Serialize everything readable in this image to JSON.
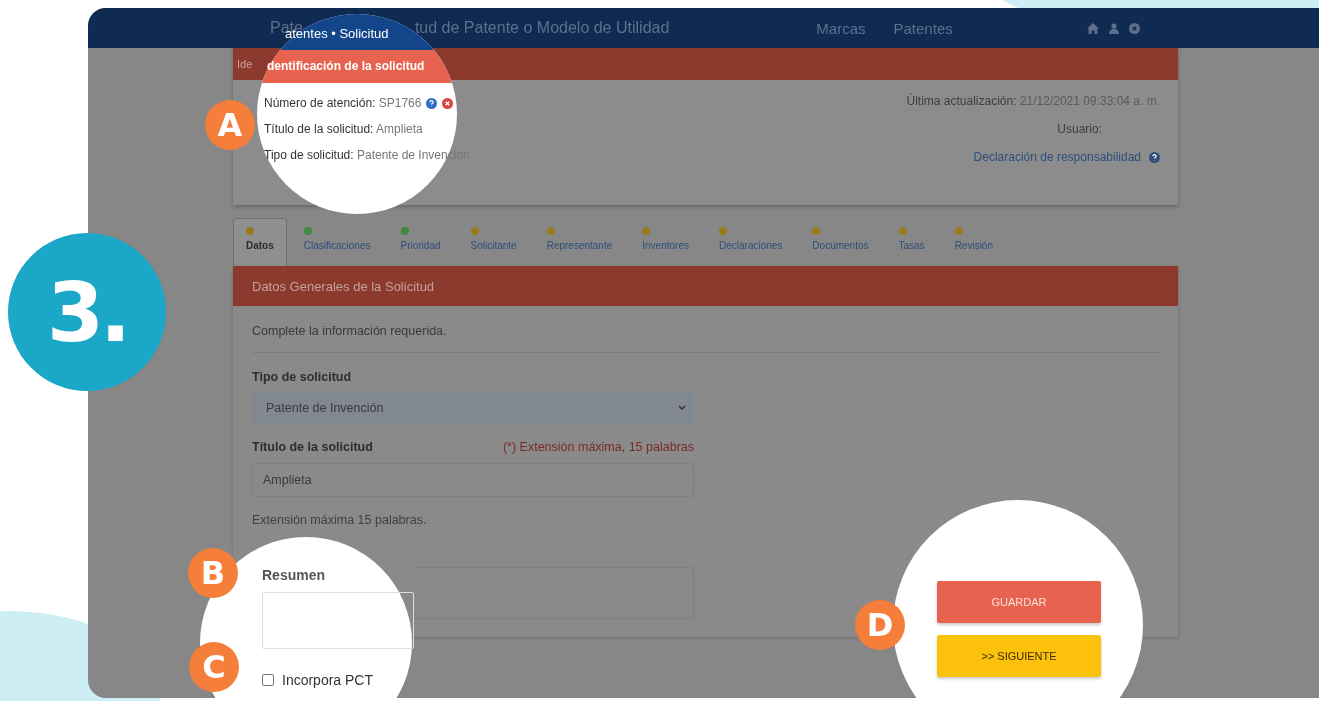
{
  "step_number": "3.",
  "header": {
    "title_left": "Pate",
    "title_right": "tud de Patente o Modelo de Utilidad",
    "nav": [
      "Marcas",
      "Patentes"
    ]
  },
  "info_card": {
    "header_fragment": "Ide",
    "last_update_label": "Última actualización:",
    "last_update_value": "21/12/2021 09:33:04 a. m.",
    "user_label": "Usuario:",
    "disclaimer_link": "Declaración de responsabilidad"
  },
  "callout_a": {
    "badge": "A",
    "breadcrumb": "atentes • Solicitud",
    "section_title": "dentificación de la solicitud",
    "lines": [
      {
        "label": "Número de atención:",
        "value": "SP1766",
        "icons": true
      },
      {
        "label": "Título de la solicitud:",
        "value": "Amplieta",
        "icons": false
      },
      {
        "label": "Tipo de solicitud:",
        "value": "Patente de Invención",
        "icons": false
      }
    ]
  },
  "tabs": [
    {
      "label": "Datos",
      "selected": true,
      "color": "#9a7a1a"
    },
    {
      "label": "Clasificaciones",
      "selected": false,
      "color": "#3f8a3f"
    },
    {
      "label": "Prioridad",
      "selected": false,
      "color": "#3f8a3f"
    },
    {
      "label": "Solicitante",
      "selected": false,
      "color": "#9a7a1a"
    },
    {
      "label": "Representante",
      "selected": false,
      "color": "#9a7a1a"
    },
    {
      "label": "Inventores",
      "selected": false,
      "color": "#9a7a1a"
    },
    {
      "label": "Declaraciones",
      "selected": false,
      "color": "#9a7a1a"
    },
    {
      "label": "Documentos",
      "selected": false,
      "color": "#9a7a1a"
    },
    {
      "label": "Tasas",
      "selected": false,
      "color": "#9a7a1a"
    },
    {
      "label": "Revisión",
      "selected": false,
      "color": "#9a7a1a"
    }
  ],
  "form": {
    "title": "Datos Generales de la Solicitud",
    "intro": "Complete la información requerida.",
    "type_label": "Tipo de solicitud",
    "type_value": "Patente de Invención",
    "title_label": "Título de la solicitud",
    "title_note": "(*) Extensión máxima, 15 palabras",
    "title_value": "Amplieta",
    "title_help": "Extensión máxima 15 palabras."
  },
  "callout_bc": {
    "badge_b": "B",
    "badge_c": "C",
    "summary_label": "Resumen",
    "pct_label": "Incorpora PCT",
    "pct_checked": false
  },
  "callout_d": {
    "badge": "D",
    "save_button": "GUARDAR",
    "next_button": ">> SIGUIENTE"
  }
}
